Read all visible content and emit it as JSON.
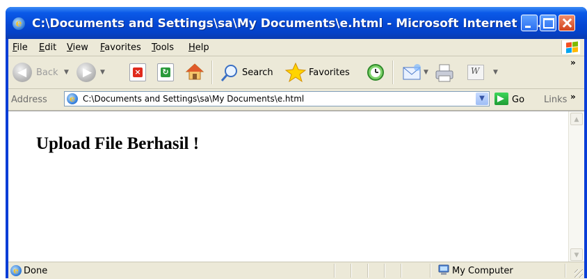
{
  "window": {
    "title": "C:\\Documents and Settings\\sa\\My Documents\\e.html - Microsoft Internet Ex..."
  },
  "menu": [
    "File",
    "Edit",
    "View",
    "Favorites",
    "Tools",
    "Help"
  ],
  "toolbar": {
    "back_label": "Back",
    "search_label": "Search",
    "favorites_label": "Favorites"
  },
  "address": {
    "label": "Address",
    "url": "C:\\Documents and Settings\\sa\\My Documents\\e.html",
    "go_label": "Go",
    "links_label": "Links"
  },
  "page": {
    "heading": "Upload File Berhasil !"
  },
  "status": {
    "text": "Done",
    "zone": "My Computer"
  },
  "icons": [
    "ie-icon",
    "minimize-icon",
    "maximize-icon",
    "close-icon",
    "windows-logo-icon",
    "back-icon",
    "forward-icon",
    "stop-icon",
    "refresh-icon",
    "home-icon",
    "search-icon",
    "favorites-star-icon",
    "history-icon",
    "mail-icon",
    "print-icon",
    "word-icon",
    "go-arrow-icon",
    "chevron-icon",
    "my-computer-icon"
  ],
  "colors": {
    "titlebar": "#0a3ed7",
    "chrome": "#ece9d8",
    "close_button": "#d2431c",
    "go_button": "#1f9c34"
  }
}
